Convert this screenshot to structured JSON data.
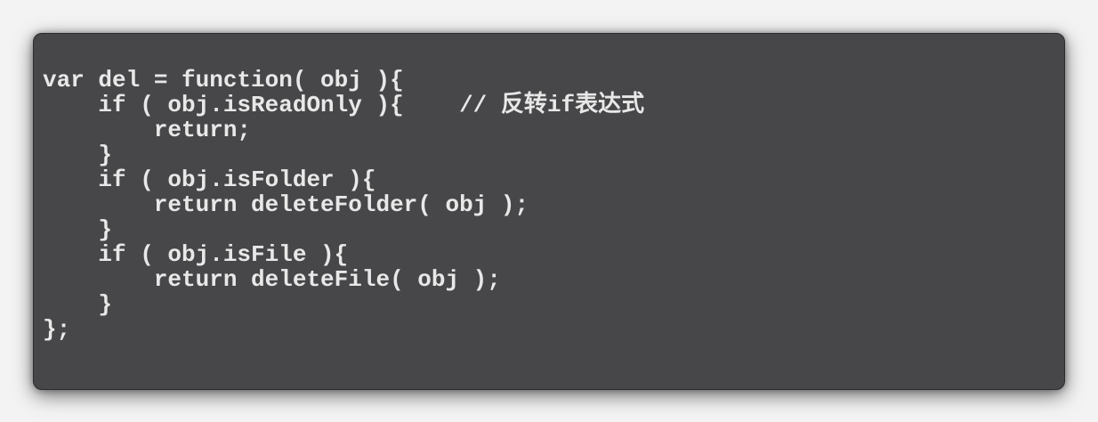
{
  "code": {
    "language": "javascript",
    "lines": [
      "var del = function( obj ){",
      "    if ( obj.isReadOnly ){    // 反转if表达式",
      "        return;",
      "    }",
      "    if ( obj.isFolder ){",
      "        return deleteFolder( obj );",
      "    }",
      "    if ( obj.isFile ){",
      "        return deleteFile( obj );",
      "    }",
      "};"
    ]
  },
  "colors": {
    "page_background": "#f3f3f3",
    "code_background": "#474749",
    "code_text": "#e8e8e8"
  }
}
